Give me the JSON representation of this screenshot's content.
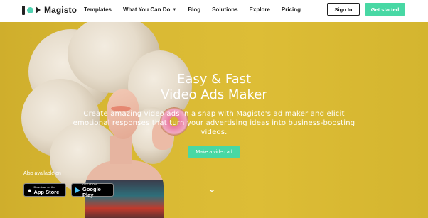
{
  "brand": {
    "name": "Magisto",
    "accent": "#48d8a4"
  },
  "nav": {
    "items": [
      {
        "label": "Templates"
      },
      {
        "label": "What You Can Do",
        "has_dropdown": true,
        "icon": "chevron-down-icon"
      },
      {
        "label": "Blog"
      },
      {
        "label": "Solutions"
      },
      {
        "label": "Explore"
      },
      {
        "label": "Pricing"
      }
    ],
    "signin_label": "Sign In",
    "getstarted_label": "Get started"
  },
  "hero": {
    "title_line1": "Easy & Fast",
    "title_line2": "Video Ads Maker",
    "subtitle": "Create amazing video ads in a snap with Magisto's ad maker and elicit emotional responses that turn your advertising ideas into business-boosting videos.",
    "cta_label": "Make a video ad",
    "scroll_icon": "chevron-down-icon"
  },
  "apps": {
    "available_label": "Also available on",
    "appstore_small": "Download on the",
    "appstore_big": "App Store",
    "gplay_small": "GET IT ON",
    "gplay_big": "Google Play"
  }
}
